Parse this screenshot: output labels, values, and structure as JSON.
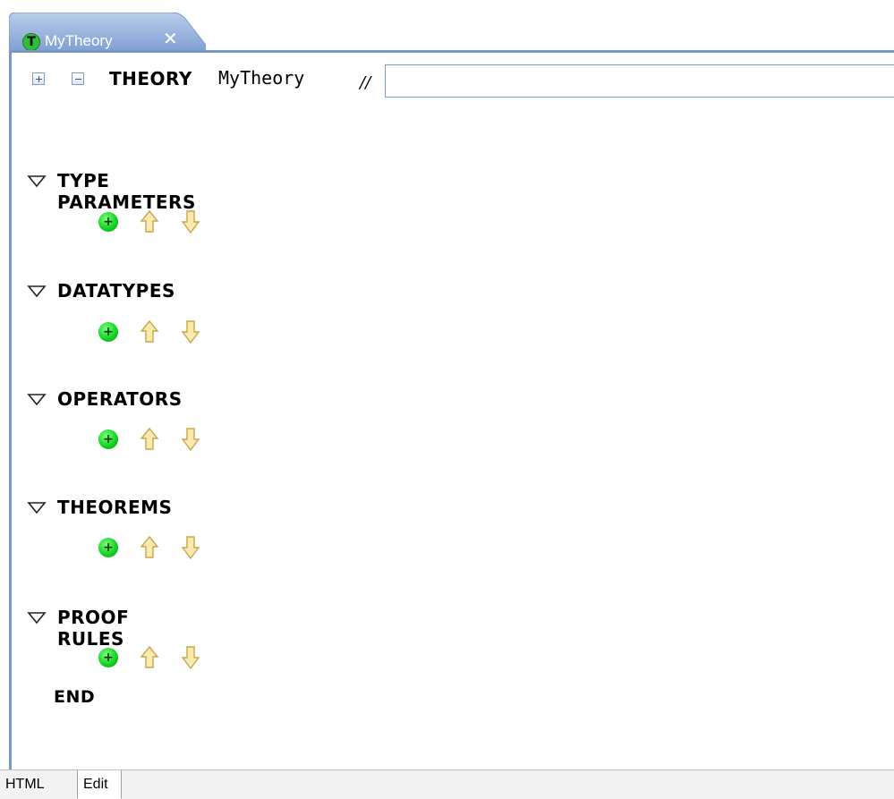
{
  "editor_tab": {
    "title": "MyTheory",
    "icon": "theory-t-icon",
    "close_symbol": "✕",
    "icon_letter": "T"
  },
  "header": {
    "expand_all": "expand-all-icon",
    "collapse_all": "collapse-all-icon",
    "keyword": "THEORY",
    "name": "MyTheory",
    "comment_marker": "//",
    "comment_value": "",
    "comment_placeholder": ""
  },
  "sections": [
    {
      "label": "TYPE PARAMETERS"
    },
    {
      "label": "DATATYPES"
    },
    {
      "label": "OPERATORS"
    },
    {
      "label": "THEOREMS"
    },
    {
      "label": "PROOF RULES"
    }
  ],
  "add_symbol": "+",
  "end_keyword": "END",
  "bottom_tabs": {
    "html": "HTML",
    "edit": "Edit",
    "active": "Edit"
  },
  "colors": {
    "tab_blue": "#7797c9",
    "add_green": "#16d926",
    "arrow_yellow": "#f7e39a"
  }
}
